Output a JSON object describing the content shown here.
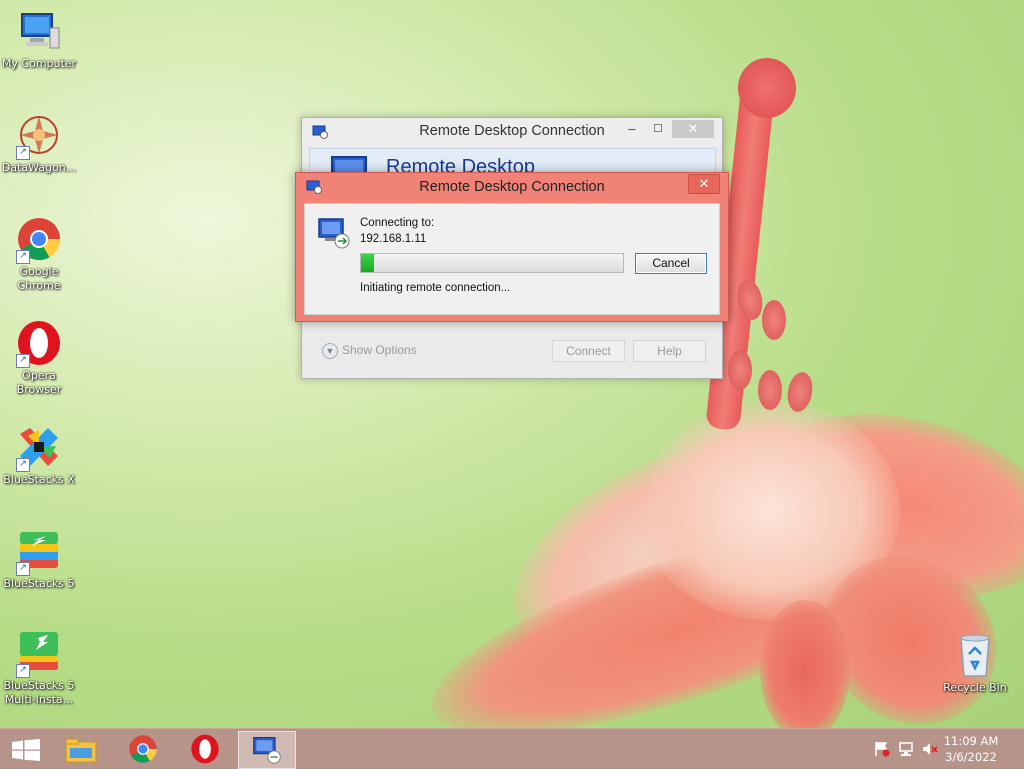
{
  "desktop": {
    "icons": [
      {
        "label": "My Computer",
        "icon": "computer-icon"
      },
      {
        "label": "DataWagon...",
        "icon": "datawagon-icon"
      },
      {
        "label": "Google Chrome",
        "icon": "chrome-icon"
      },
      {
        "label": "Opera Browser",
        "icon": "opera-icon"
      },
      {
        "label": "BlueStacks X",
        "icon": "bluestacks-x-icon"
      },
      {
        "label": "BlueStacks 5",
        "icon": "bluestacks-5-icon"
      },
      {
        "label": "BlueStacks 5 Multi-Insta...",
        "icon": "bluestacks-multi-icon"
      },
      {
        "label": "Recycle Bin",
        "icon": "recycle-bin-icon"
      }
    ]
  },
  "main_window": {
    "title": "Remote Desktop Connection",
    "header_text": "Remote Desktop",
    "show_options": "Show Options",
    "connect_label": "Connect",
    "help_label": "Help",
    "minimize": "–",
    "maximize": "☐",
    "close": "✕"
  },
  "dialog": {
    "title": "Remote Desktop Connection",
    "connecting_to_label": "Connecting to:",
    "address": "192.168.1.11",
    "status": "Initiating remote connection...",
    "cancel_label": "Cancel",
    "close": "✕",
    "progress": 0.05
  },
  "taskbar": {
    "items": [
      "start-icon",
      "file-explorer-icon",
      "chrome-icon",
      "opera-icon",
      "remote-desktop-icon"
    ],
    "active_item": "remote-desktop-icon",
    "tray": [
      "action-center-flag-icon",
      "network-icon",
      "volume-muted-icon"
    ],
    "time": "11:09 AM",
    "date": "3/6/2022"
  },
  "colors": {
    "accent_title": "#f08376",
    "progress_fill": "#19a824",
    "taskbar": "#b6948a"
  }
}
